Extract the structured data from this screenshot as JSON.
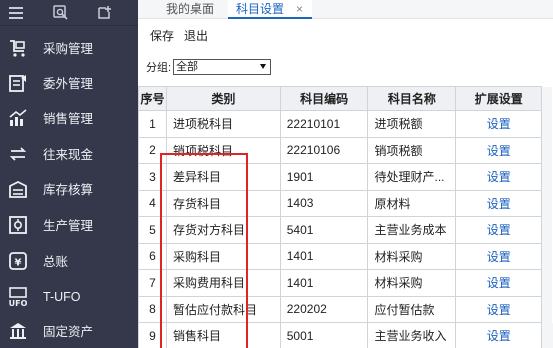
{
  "sidebar": {
    "top_icons": [
      "menu-icon",
      "search-icon",
      "add-icon"
    ],
    "items": [
      {
        "label": "采购管理",
        "icon": "purchase-icon"
      },
      {
        "label": "委外管理",
        "icon": "outsource-icon"
      },
      {
        "label": "销售管理",
        "icon": "sales-chart-icon"
      },
      {
        "label": "往来现金",
        "icon": "exchange-icon"
      },
      {
        "label": "库存核算",
        "icon": "warehouse-icon"
      },
      {
        "label": "生产管理",
        "icon": "production-icon"
      },
      {
        "label": "总账",
        "icon": "ledger-icon"
      },
      {
        "label": "T-UFO",
        "icon": "ufo-icon"
      },
      {
        "label": "固定资产",
        "icon": "bank-icon"
      }
    ]
  },
  "tabs": [
    {
      "label": "我的桌面"
    },
    {
      "label": "科目设置",
      "close": "×"
    }
  ],
  "toolbar": {
    "save": "保存",
    "exit": "退出"
  },
  "filter": {
    "label": "分组:",
    "value": "全部"
  },
  "table": {
    "headers": {
      "no": "序号",
      "category": "类别",
      "code": "科目编码",
      "name": "科目名称",
      "ext": "扩展设置"
    },
    "rows": [
      {
        "no": "1",
        "category": "进项税科目",
        "code": "22210101",
        "name": "进项税额",
        "action": "设置"
      },
      {
        "no": "2",
        "category": "销项税科目",
        "code": "22210106",
        "name": "销项税额",
        "action": "设置"
      },
      {
        "no": "3",
        "category": "差异科目",
        "code": "1901",
        "name": "待处理财产...",
        "action": "设置"
      },
      {
        "no": "4",
        "category": "存货科目",
        "code": "1403",
        "name": "原材料",
        "action": "设置"
      },
      {
        "no": "5",
        "category": "存货对方科目",
        "code": "5401",
        "name": "主营业务成本",
        "action": "设置"
      },
      {
        "no": "6",
        "category": "采购科目",
        "code": "1401",
        "name": "材料采购",
        "action": "设置"
      },
      {
        "no": "7",
        "category": "采购费用科目",
        "code": "1401",
        "name": "材料采购",
        "action": "设置"
      },
      {
        "no": "8",
        "category": "暂估应付款科目",
        "code": "220202",
        "name": "应付暂估款",
        "action": "设置"
      },
      {
        "no": "9",
        "category": "销售科目",
        "code": "5001",
        "name": "主营业务收入",
        "action": "设置"
      }
    ]
  },
  "colors": {
    "sidebar_bg": "#34384a",
    "accent": "#1a66c0",
    "highlight": "#e02424"
  }
}
